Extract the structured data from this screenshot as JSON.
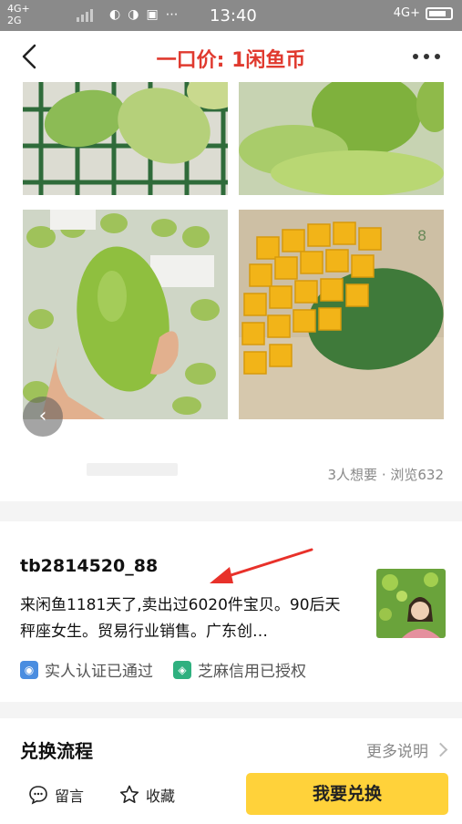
{
  "status_bar": {
    "network_1": "4G+",
    "network_2": "2G",
    "time": "13:40",
    "network_right": "4G+"
  },
  "header": {
    "title": "一口价: 1闲鱼币",
    "back_icon": "back-chevron-icon",
    "more_icon": "more-dots-icon"
  },
  "listing": {
    "stats": "3人想要 · 浏览632",
    "photos": [
      "mango-in-crate",
      "mangoes-closeup",
      "hand-holding-mango",
      "cut-mango-cubes"
    ]
  },
  "seller": {
    "name": "tb2814520_88",
    "bio": "来闲鱼1181天了,卖出过6020件宝贝。90后天秤座女生。贸易行业销售。广东创…",
    "verified_label": "实人认证已通过",
    "credit_label": "芝麻信用已授权"
  },
  "exchange": {
    "title": "兑换流程",
    "more_label": "更多说明"
  },
  "bottom_bar": {
    "message_label": "留言",
    "favorite_label": "收藏",
    "cta_label": "我要兑换"
  },
  "colors": {
    "title_red": "#e03a2f",
    "cta_yellow": "#ffd23a",
    "verify_blue": "#4a8de0",
    "credit_green": "#2fb07f"
  }
}
